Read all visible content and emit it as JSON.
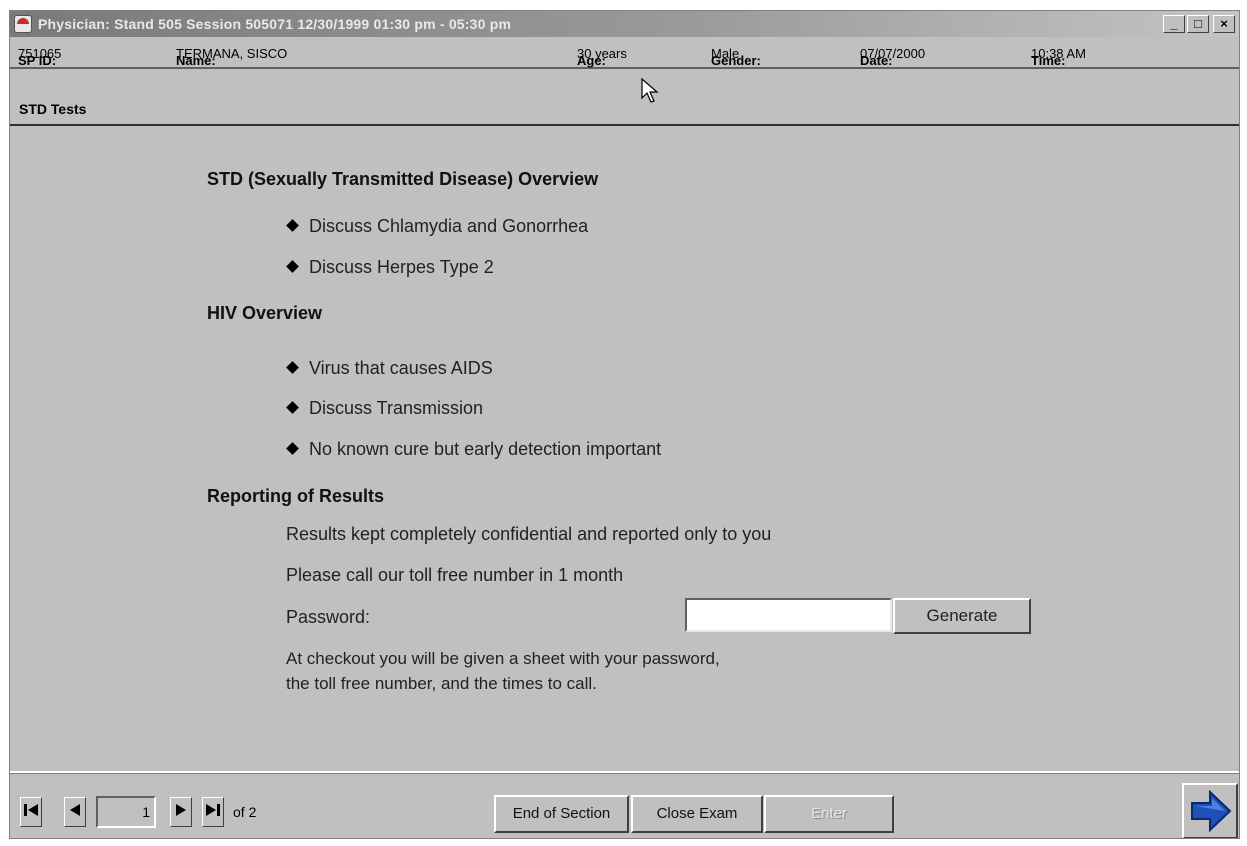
{
  "window": {
    "title": "Physician: Stand 505 Session 505071 12/30/1999 01:30 pm - 05:30 pm",
    "controls": {
      "minimize": "_",
      "maximize": "□",
      "close": "×"
    }
  },
  "header": {
    "sp_id_label": "SP ID:",
    "sp_id": "751065",
    "name_label": "Name:",
    "name": "TERMANA, SISCO",
    "age_label": "Age:",
    "age": "30 years",
    "gender_label": "Gender:",
    "gender": "Male",
    "date_label": "Date:",
    "date": "07/07/2000",
    "time_label": "Time:",
    "time": "10:38 AM"
  },
  "section": {
    "title": "STD Tests"
  },
  "content": {
    "std_heading": "STD (Sexually Transmitted Disease) Overview",
    "std_items": [
      "Discuss Chlamydia and Gonorrhea",
      "Discuss Herpes Type 2"
    ],
    "hiv_heading": "HIV Overview",
    "hiv_items": [
      "Virus that causes AIDS",
      "Discuss Transmission",
      "No known cure but early detection important"
    ],
    "reporting_heading": "Reporting of Results",
    "reporting_line1": "Results kept completely confidential and reported only to you",
    "reporting_line2": "Please call our toll free number in 1 month",
    "password_label": "Password:",
    "password_value": "",
    "generate_label": "Generate",
    "checkout_line1": "At checkout you will be given a sheet with your password,",
    "checkout_line2": "the toll free number, and the times to call."
  },
  "footer": {
    "current_page": "1",
    "page_of": "of 2",
    "end_of_section": "End of Section",
    "close_exam": "Close Exam",
    "third_button": "Enter"
  },
  "icons": {
    "first": "first-page-icon",
    "prev": "previous-page-icon",
    "next": "next-page-icon",
    "last": "last-page-icon",
    "continue": "next-arrow-icon"
  },
  "colors": {
    "window_bg": "#c0c0c0",
    "arrow_blue": "#1f4fb8"
  }
}
